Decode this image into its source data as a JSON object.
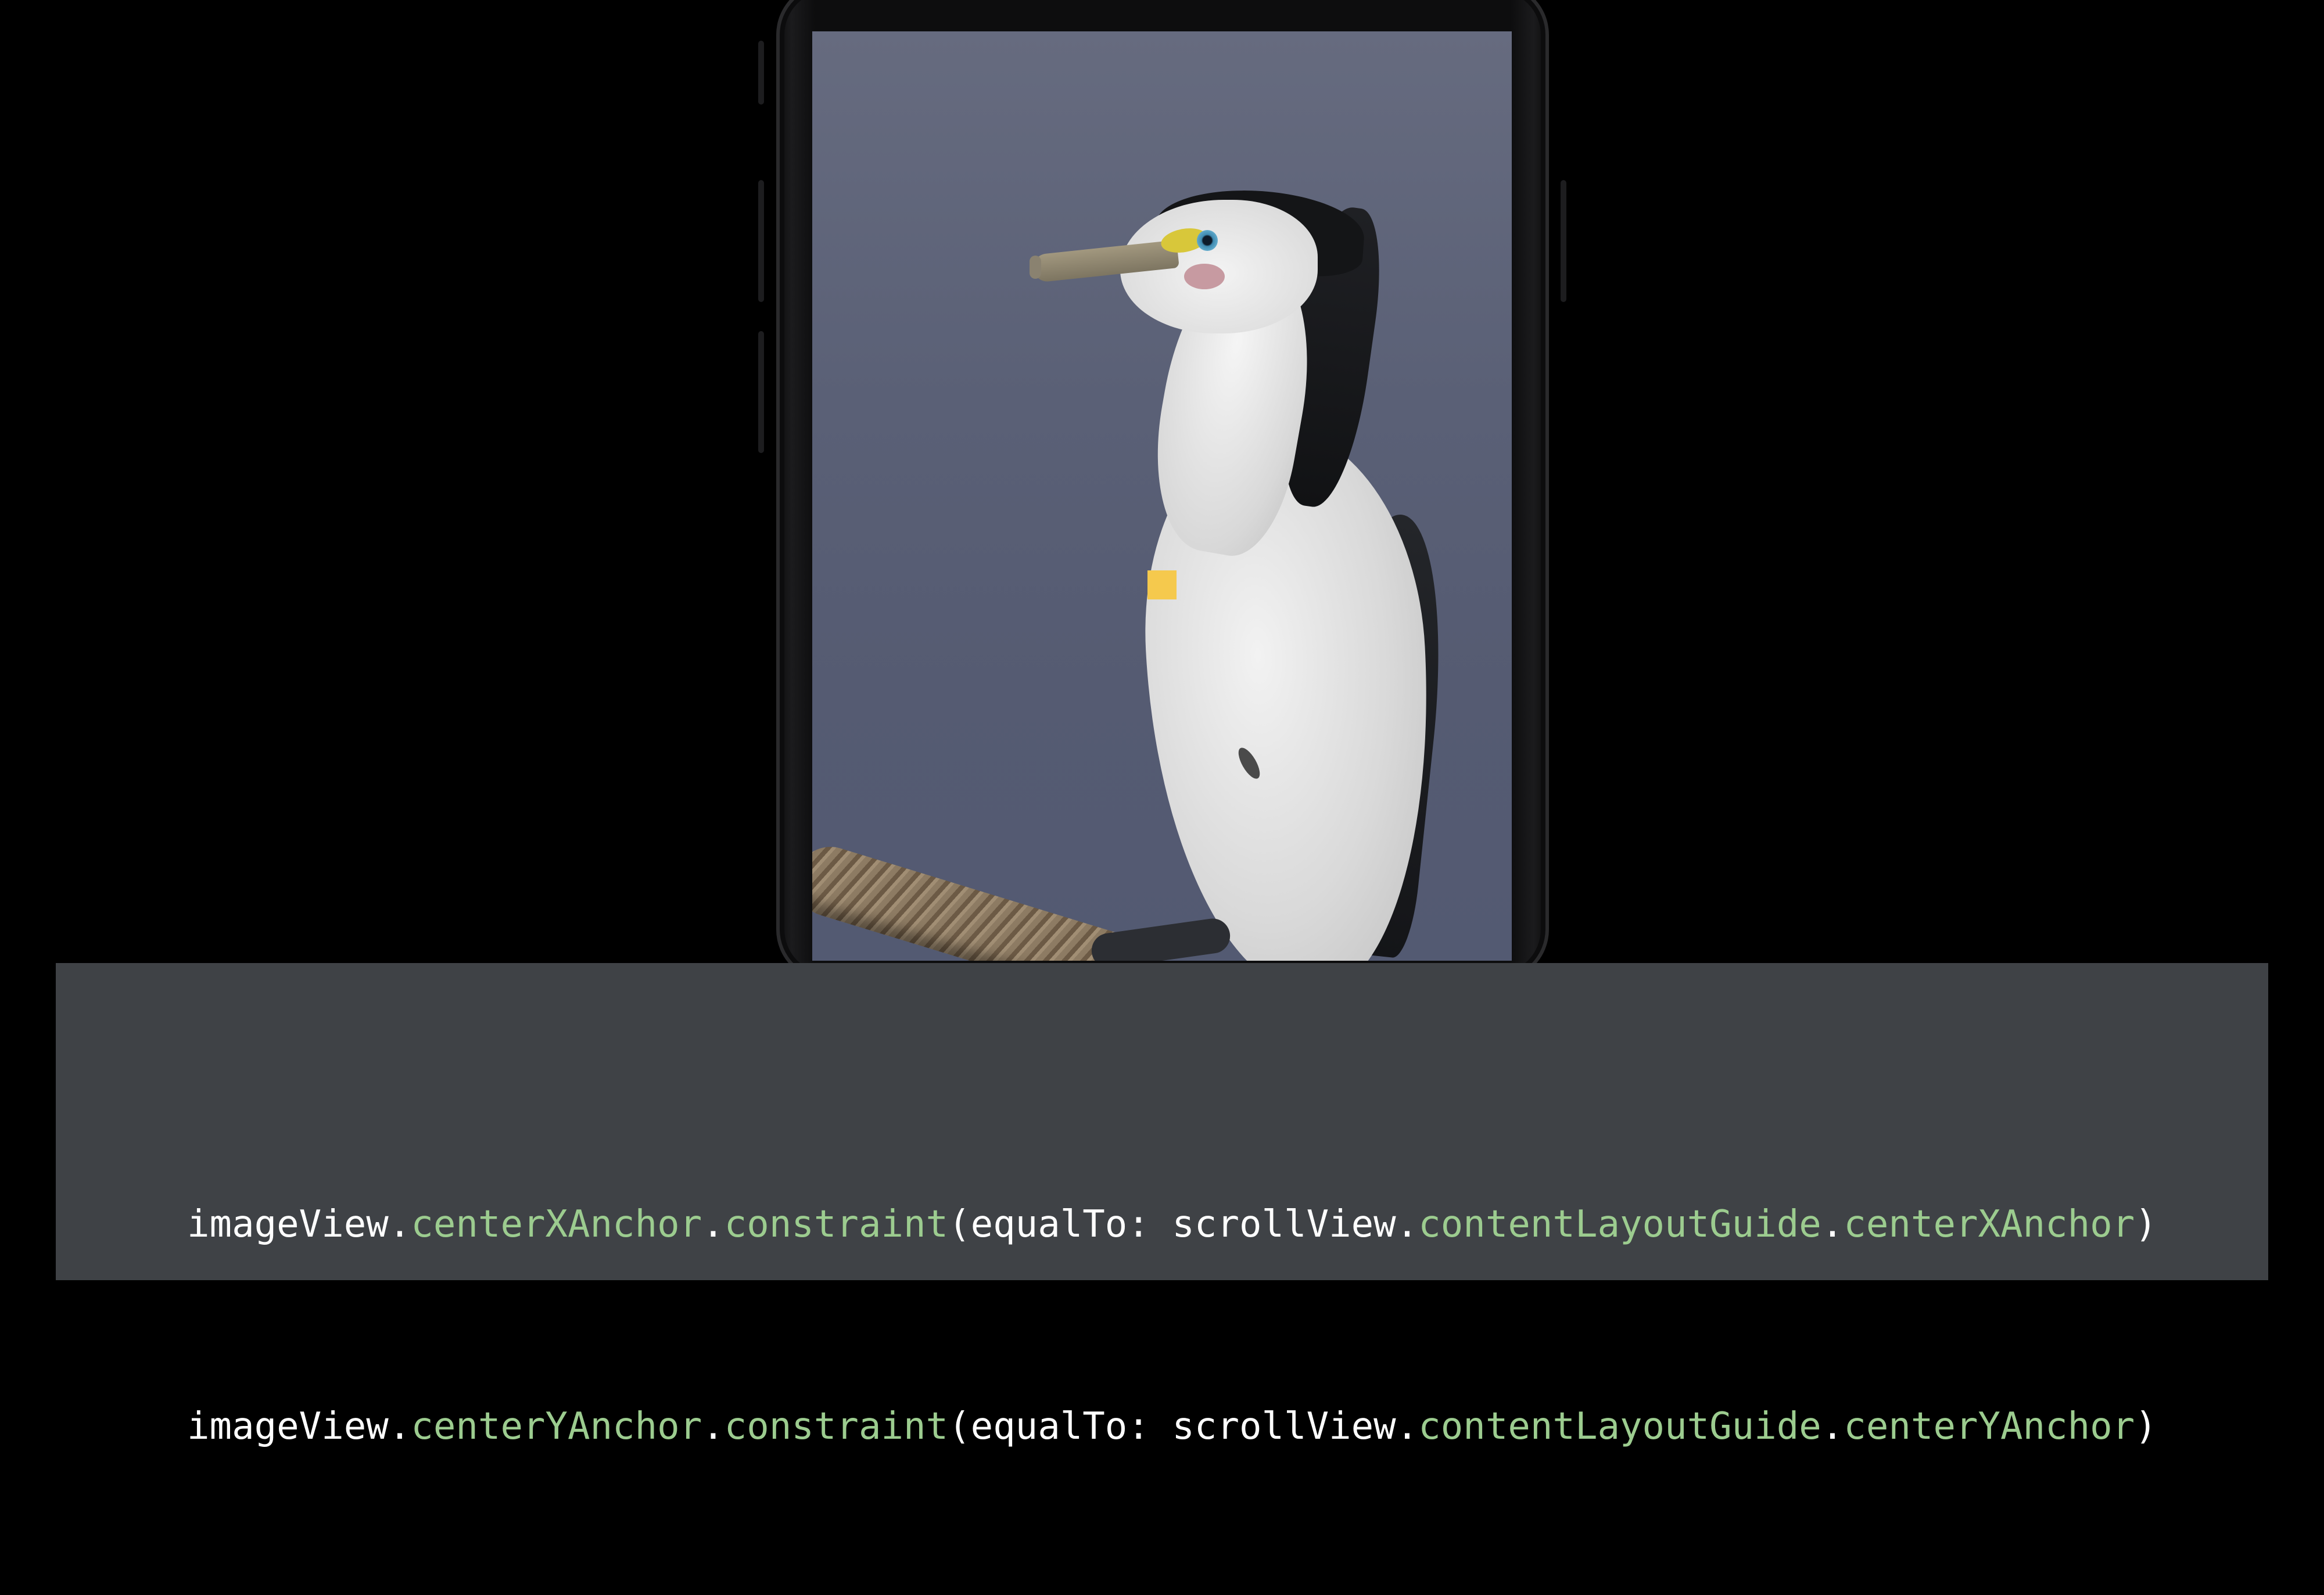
{
  "screen": {
    "image_subject_icon": "cormorant-bird-photo",
    "marker_color": "#f5c94d"
  },
  "code": {
    "lines": [
      {
        "object": "imageView",
        "dot1": ".",
        "anchor": "centerXAnchor",
        "dot2": ".",
        "method": "constraint",
        "arg_open": "(equalTo: ",
        "target": "scrollView",
        "dot3": ".",
        "guide": "contentLayoutGuide",
        "dot4": ".",
        "target_anchor": "centerXAnchor",
        "close": ")"
      },
      {
        "object": "imageView",
        "dot1": ".",
        "anchor": "centerYAnchor",
        "dot2": ".",
        "method": "constraint",
        "arg_open": "(equalTo: ",
        "target": "scrollView",
        "dot3": ".",
        "guide": "contentLayoutGuide",
        "dot4": ".",
        "target_anchor": "centerYAnchor",
        "close": ")"
      }
    ],
    "colors": {
      "plain": "#ffffff",
      "property": "#9ccc8f",
      "panel": "#3f4246"
    }
  }
}
